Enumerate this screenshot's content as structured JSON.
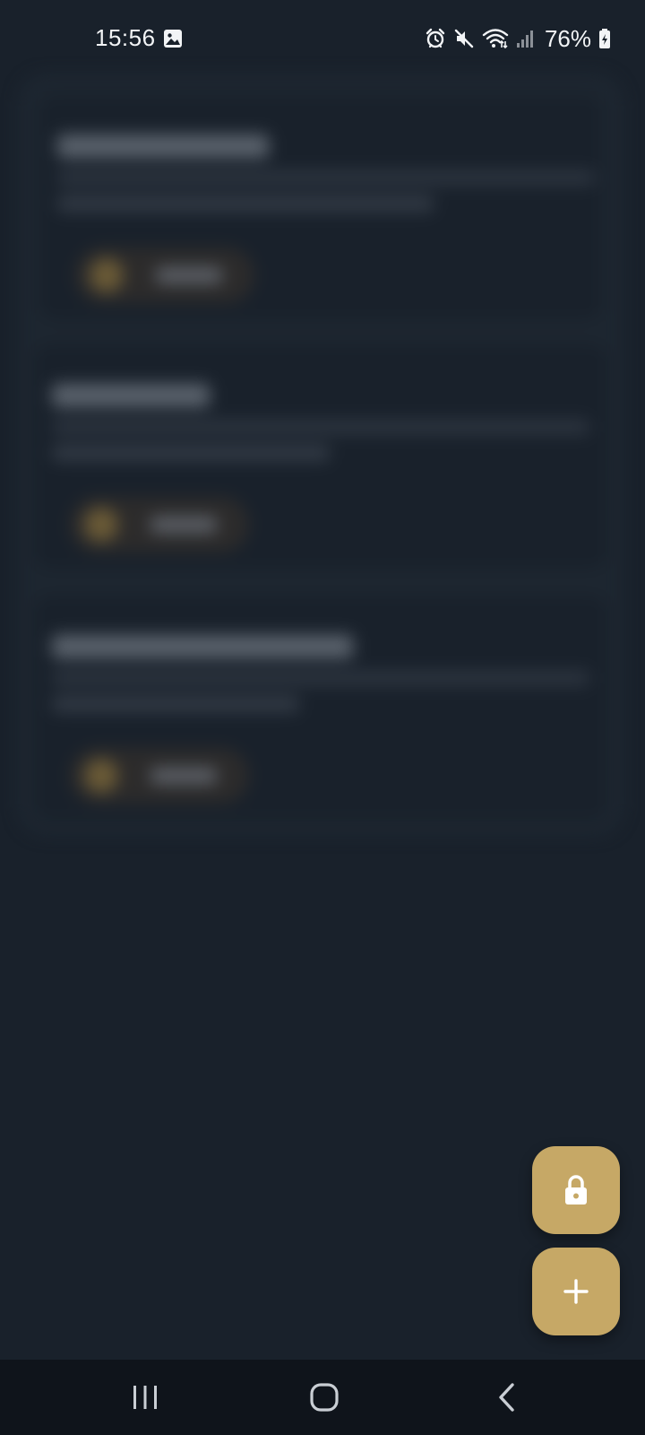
{
  "status_bar": {
    "time": "15:56",
    "battery_percent": "76%",
    "icons": [
      "image-icon",
      "alarm-icon",
      "mute-icon",
      "wifi-icon",
      "signal-icon",
      "battery-charging-icon"
    ]
  },
  "background_content": {
    "blurred": true,
    "cards": 3
  },
  "fabs": {
    "lock": {
      "icon": "lock-icon"
    },
    "add": {
      "icon": "plus-icon"
    }
  },
  "nav_bar": {
    "buttons": [
      "recent-apps",
      "home",
      "back"
    ]
  },
  "colors": {
    "background": "#19212b",
    "card": "#1d2630",
    "accent": "#c6a866",
    "nav_bar": "#0f141b"
  }
}
